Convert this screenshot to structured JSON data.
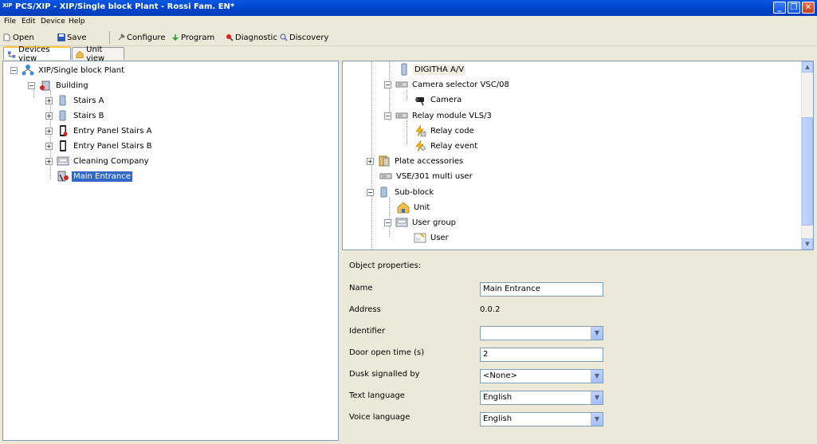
{
  "window": {
    "app_icon_text": "XIP",
    "title": "PCS/XIP - XIP/Single block Plant - Rossi Fam. EN*"
  },
  "menu": [
    "File",
    "Edit",
    "Device",
    "Help"
  ],
  "toolbar": {
    "open": "Open",
    "save": "Save",
    "configure": "Configure",
    "program": "Program",
    "diagnostic": "Diagnostic",
    "discovery": "Discovery"
  },
  "tabs": {
    "devices_view": "Devices view",
    "unit_view": "Unit view"
  },
  "left_tree": {
    "root": "XIP/Single block Plant",
    "building": "Building",
    "stairs_a": "Stairs A",
    "stairs_b": "Stairs B",
    "entry_panel_a": "Entry Panel Stairs A",
    "entry_panel_b": "Entry Panel Stairs B",
    "cleaning_company": "Cleaning Company",
    "main_entrance": "Main Entrance"
  },
  "right_tree": {
    "digitha": "DIGITHA A/V",
    "camera_selector": "Camera selector VSC/08",
    "camera": "Camera",
    "relay_module": "Relay module VLS/3",
    "relay_code": "Relay code",
    "relay_event": "Relay event",
    "plate_accessories": "Plate accessories",
    "vse": "VSE/301 multi user",
    "sub_block": "Sub-block",
    "unit": "Unit",
    "user_group": "User group",
    "user": "User"
  },
  "properties": {
    "heading": "Object properties:",
    "name_label": "Name",
    "name_value": "Main Entrance",
    "address_label": "Address",
    "address_value": "0.0.2",
    "identifier_label": "Identifier",
    "identifier_value": "",
    "door_open_label": "Door open time (s)",
    "door_open_value": "2",
    "dusk_label": "Dusk signalled by",
    "dusk_value": "<None>",
    "text_lang_label": "Text language",
    "text_lang_value": "English",
    "voice_lang_label": "Voice language",
    "voice_lang_value": "English"
  }
}
